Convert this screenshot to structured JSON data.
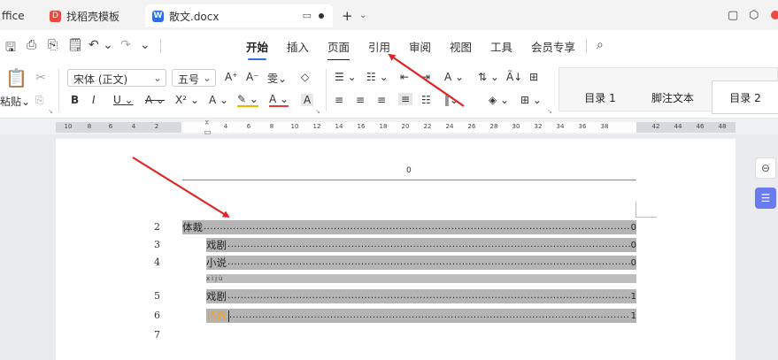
{
  "tabs": {
    "office": "ffice",
    "template": "找稻壳模板",
    "template_icon": "D",
    "doc": "散文.docx",
    "doc_icon": "W",
    "new_tab": "+",
    "new_tab_caret": "⌄"
  },
  "window": {
    "restore_icon": "▢",
    "settings_icon": "⬡"
  },
  "quick_access": [
    "🖫",
    "⎙",
    "⎘",
    "🗒",
    "↶ ⌄",
    "↷",
    "⌄"
  ],
  "menu": {
    "items": [
      "开始",
      "插入",
      "页面",
      "引用",
      "审阅",
      "视图",
      "工具",
      "会员专享"
    ],
    "search_icon": "⌕"
  },
  "ribbon": {
    "paste_label": "粘贴⌄",
    "font_name": "宋体 (正文)",
    "font_size": "五号",
    "grow_font": "A⁺",
    "shrink_font": "A⁻",
    "phonetic": "雯⌄",
    "clear_format": "◇",
    "bold": "B",
    "italic": "I",
    "underline": "U ⌄",
    "strikethrough": "A ⌄",
    "superscript": "X² ⌄",
    "text_effect": "A ⌄",
    "highlight": "✎ ⌄",
    "font_color": "A ⌄",
    "char_shade": "A",
    "bullets": "☰ ⌄",
    "numbering": "☷ ⌄",
    "decrease_indent": "⇤",
    "increase_indent": "⇥",
    "chinese_layout": "A ⌄",
    "sort": "⇅ ⌄",
    "para": "Ã↓",
    "border_icon": "⊞",
    "align": [
      "≡",
      "≡",
      "≡",
      "≡",
      "☷"
    ],
    "line_spacing": "‖⌄",
    "shading": "◈ ⌄",
    "borders": "⊞ ⌄",
    "styles": [
      "目录 1",
      "脚注文本",
      "目录 2"
    ]
  },
  "ruler": {
    "left_numbers": [
      "10",
      "8",
      "6",
      "4",
      "2"
    ],
    "right_numbers": [
      "4",
      "6",
      "8",
      "10",
      "12",
      "14",
      "16",
      "18",
      "20",
      "22",
      "24",
      "26",
      "28",
      "30",
      "32",
      "34",
      "36",
      "38",
      "42",
      "44",
      "46",
      "48"
    ]
  },
  "document": {
    "header_text": "0",
    "rows": [
      {
        "line": "2",
        "text": "体裁",
        "page": "0"
      },
      {
        "line": "3",
        "text": "戏剧",
        "page": "0"
      },
      {
        "line": "4",
        "text": "小说",
        "page": "0"
      },
      {
        "line": "5",
        "text": "戏剧",
        "page": "1"
      },
      {
        "line": "6",
        "text": "诗歌",
        "page": "1"
      },
      {
        "line": "7",
        "text": "",
        "page": ""
      }
    ],
    "pinyin": "xìjù",
    "dots": "......................................................................................................................................................"
  },
  "side_panel": {
    "collapse_icon": "⊖",
    "doc_icon": "☰"
  },
  "colors": {
    "accent": "#2f6fe6",
    "arrow": "#e02424",
    "toc_highlight": "#b4b4b4",
    "orange_text": "#f2a11e"
  }
}
